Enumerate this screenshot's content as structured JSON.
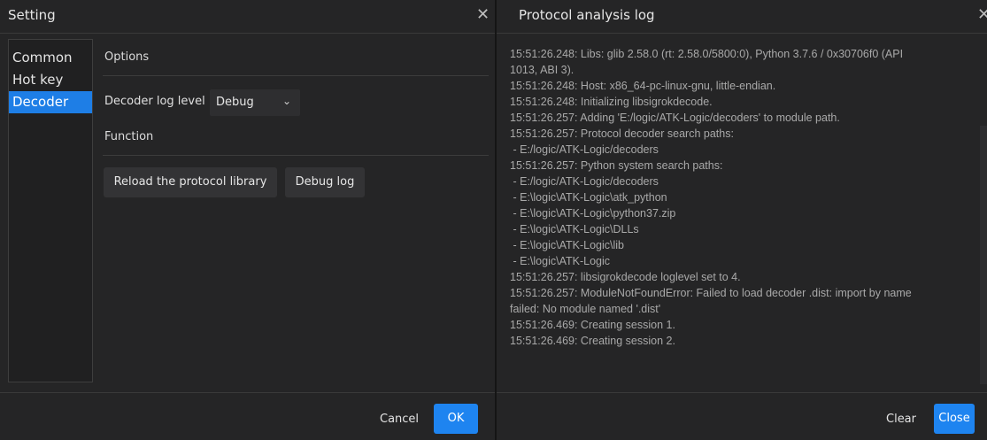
{
  "settings": {
    "title": "Setting",
    "close_glyph": "✕",
    "nav": [
      {
        "label": "Common"
      },
      {
        "label": "Hot key"
      },
      {
        "label": "Decoder"
      }
    ],
    "active_nav_index": 2,
    "options_header": "Options",
    "decoder_log_label": "Decoder log level",
    "decoder_log_value": "Debug",
    "dropdown_glyph": "⌄",
    "function_header": "Function",
    "reload_button": "Reload the protocol library",
    "debug_log_button": "Debug log",
    "cancel_button": "Cancel",
    "ok_button": "OK"
  },
  "log_window": {
    "title": "Protocol analysis log",
    "close_glyph": "✕",
    "lines": [
      "15:51:26.248: Libs: glib 2.58.0 (rt: 2.58.0/5800:0), Python 3.7.6 / 0x30706f0 (API",
      "1013, ABI 3).",
      "15:51:26.248: Host: x86_64-pc-linux-gnu, little-endian.",
      "15:51:26.248: Initializing libsigrokdecode.",
      "15:51:26.257: Adding 'E:/logic/ATK-Logic/decoders' to module path.",
      "15:51:26.257: Protocol decoder search paths:",
      " - E:/logic/ATK-Logic/decoders",
      "15:51:26.257: Python system search paths:",
      " - E:/logic/ATK-Logic/decoders",
      " - E:\\logic\\ATK-Logic\\atk_python",
      " - E:\\logic\\ATK-Logic\\python37.zip",
      " - E:\\logic\\ATK-Logic\\DLLs",
      " - E:\\logic\\ATK-Logic\\lib",
      " - E:\\logic\\ATK-Logic",
      "15:51:26.257: libsigrokdecode loglevel set to 4.",
      "15:51:26.257: ModuleNotFoundError: Failed to load decoder .dist: import by name",
      "failed: No module named '.dist'",
      "15:51:26.469: Creating session 1.",
      "15:51:26.469: Creating session 2."
    ],
    "clear_button": "Clear",
    "close_button": "Close"
  },
  "colors": {
    "accent": "#1e84f0",
    "background": "#252526",
    "log_text": "#a9a9a9"
  }
}
